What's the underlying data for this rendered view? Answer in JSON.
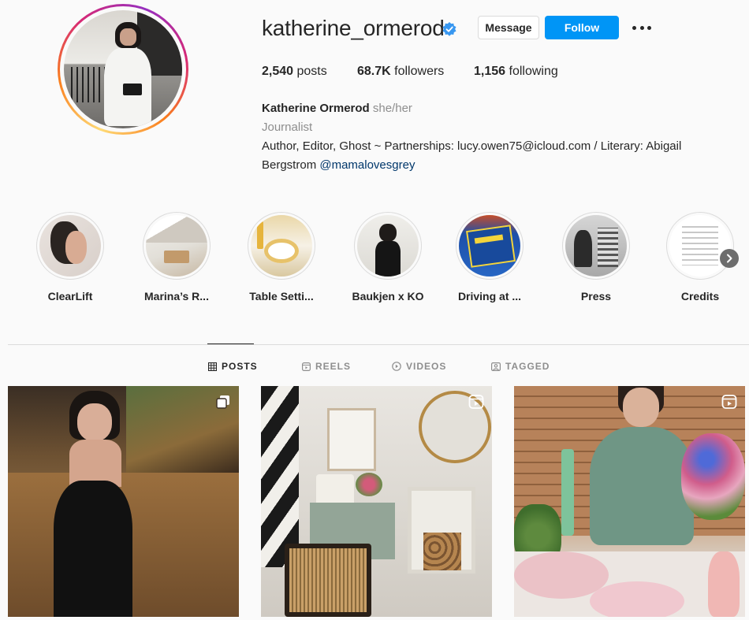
{
  "profile": {
    "username": "katherine_ormerod",
    "verified": true,
    "message_label": "Message",
    "follow_label": "Follow",
    "stats": {
      "posts_count": "2,540",
      "posts_label": "posts",
      "followers_count": "68.7K",
      "followers_label": "followers",
      "following_count": "1,156",
      "following_label": "following"
    },
    "bio": {
      "name": "Katherine Ormerod",
      "pronouns": "she/her",
      "category": "Journalist",
      "text": "Author, Editor, Ghost ~ Partnerships: lucy.owen75@icloud.com / Literary: Abigail Bergstrom",
      "mention": "@mamalovesgrey"
    }
  },
  "highlights": [
    {
      "label": "ClearLift",
      "cover": "clearlift"
    },
    {
      "label": "Marina’s R...",
      "cover": "marina"
    },
    {
      "label": "Table Setti...",
      "cover": "table"
    },
    {
      "label": "Baukjen x KO",
      "cover": "baukjen"
    },
    {
      "label": "Driving at ...",
      "cover": "driving"
    },
    {
      "label": "Press",
      "cover": "press"
    },
    {
      "label": "Credits",
      "cover": "credits"
    }
  ],
  "tabs": [
    {
      "label": "POSTS",
      "icon": "grid-icon",
      "active": true
    },
    {
      "label": "REELS",
      "icon": "reels-icon",
      "active": false
    },
    {
      "label": "VIDEOS",
      "icon": "play-circle-icon",
      "active": false
    },
    {
      "label": "TAGGED",
      "icon": "tag-icon",
      "active": false
    }
  ],
  "posts": [
    {
      "type_icon": "carousel-icon"
    },
    {
      "type_icon": "reel-icon"
    },
    {
      "type_icon": "reel-icon"
    }
  ],
  "colors": {
    "accent": "#0095f6",
    "verified": "#3897f0",
    "text": "#262626",
    "secondary_text": "#8e8e8e",
    "link": "#00376b",
    "background": "#fafafa"
  }
}
